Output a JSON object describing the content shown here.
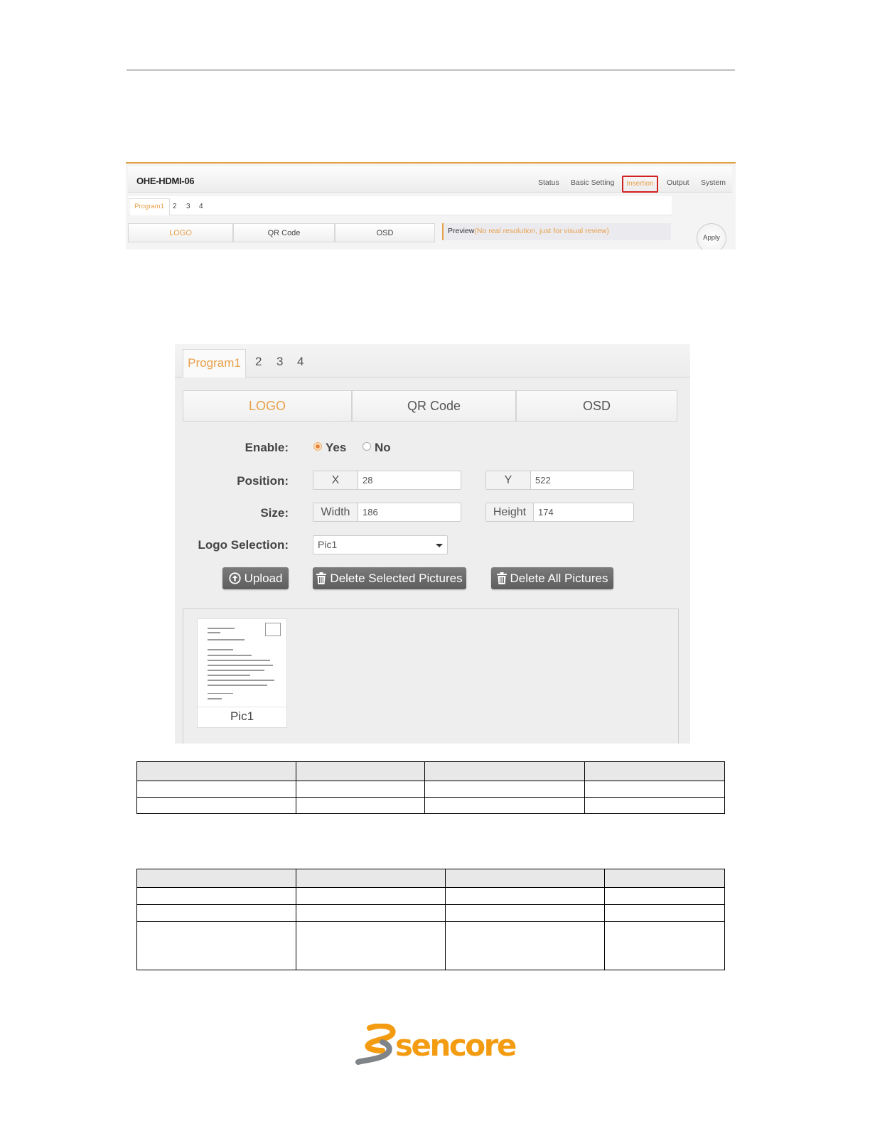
{
  "screenshot_top": {
    "app_title": "OHE-HDMI-06",
    "nav": [
      "Status",
      "Basic Setting",
      "Insertion",
      "Output",
      "System"
    ],
    "active_nav": "Insertion",
    "program_tabs": [
      "Program1",
      "2",
      "3",
      "4"
    ],
    "sub_tabs": [
      "LOGO",
      "QR Code",
      "OSD"
    ],
    "preview_label": "Preview",
    "preview_note": "(No real resolution, just for visual review)",
    "apply_label": "Apply"
  },
  "screenshot_panel": {
    "program_tabs": [
      "Program1",
      "2",
      "3",
      "4"
    ],
    "sub_tabs": [
      "LOGO",
      "QR Code",
      "OSD"
    ],
    "enable_label": "Enable:",
    "enable_yes": "Yes",
    "enable_no": "No",
    "enable_value": "Yes",
    "position_label": "Position:",
    "x_label": "X",
    "x_value": "28",
    "y_label": "Y",
    "y_value": "522",
    "size_label": "Size:",
    "width_label": "Width",
    "width_value": "186",
    "height_label": "Height",
    "height_value": "174",
    "logo_selection_label": "Logo Selection:",
    "logo_selection_value": "Pic1",
    "upload_label": "Upload",
    "delete_selected_label": "Delete Selected Pictures",
    "delete_all_label": "Delete All Pictures",
    "gallery": [
      {
        "caption": "Pic1",
        "checked": false
      }
    ]
  },
  "colors": {
    "accent": "#e8a04a",
    "active_nav_border": "#d32020",
    "button": "#6a6a6a",
    "brand_orange": "#f39c12",
    "brand_grey": "#7f8489"
  },
  "footer": {
    "brand": "sencore"
  }
}
